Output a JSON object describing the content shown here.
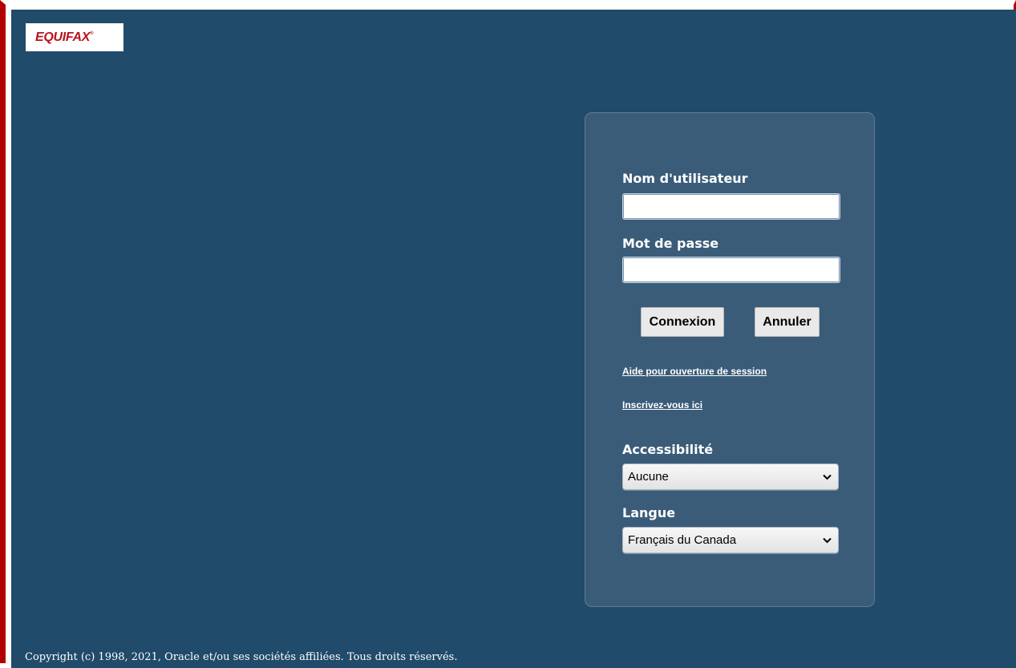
{
  "brand": {
    "logo_text": "EQUIFAX",
    "logo_mark": "®",
    "logo_color": "#b8131f"
  },
  "login": {
    "username_label": "Nom d'utilisateur",
    "username_value": "",
    "password_label": "Mot de passe",
    "password_value": "",
    "connect_label": "Connexion",
    "cancel_label": "Annuler",
    "help_link": "Aide pour ouverture de session",
    "register_link": "Inscrivez-vous ici",
    "accessibility_label": "Accessibilité",
    "accessibility_value": "Aucune",
    "language_label": "Langue",
    "language_value": "Français du Canada"
  },
  "footer": {
    "copyright": "Copyright (c) 1998, 2021, Oracle et/ou ses sociétés affiliées. Tous droits réservés."
  },
  "colors": {
    "background": "#204b6a",
    "panel": "#3a5c79",
    "frame_border": "#b40000"
  },
  "icons": {
    "dropdown": "chevron-down-icon"
  }
}
